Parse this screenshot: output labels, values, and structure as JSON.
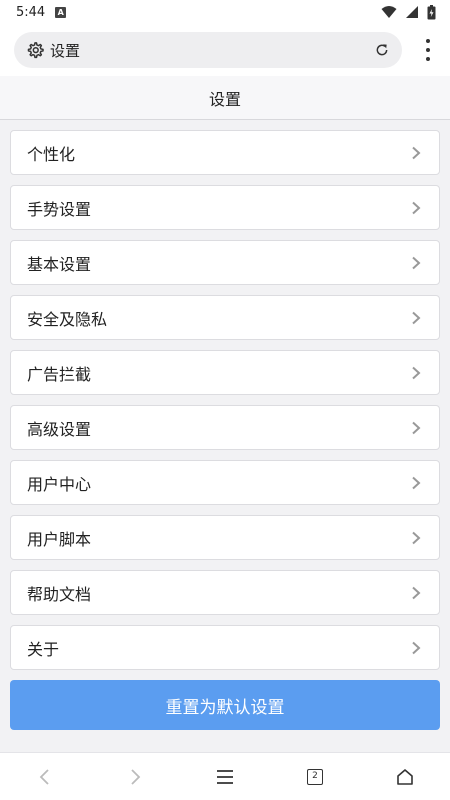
{
  "status": {
    "time": "5:44",
    "notification": "A"
  },
  "address_bar": {
    "text": "设置"
  },
  "header": {
    "title": "设置"
  },
  "settings_items": [
    {
      "label": "个性化"
    },
    {
      "label": "手势设置"
    },
    {
      "label": "基本设置"
    },
    {
      "label": "安全及隐私"
    },
    {
      "label": "广告拦截"
    },
    {
      "label": "高级设置"
    },
    {
      "label": "用户中心"
    },
    {
      "label": "用户脚本"
    },
    {
      "label": "帮助文档"
    },
    {
      "label": "关于"
    }
  ],
  "reset_button": {
    "label": "重置为默认设置"
  },
  "bottom_bar": {
    "tab_count": "2"
  },
  "colors": {
    "accent": "#5b9df0",
    "background": "#f2f2f4"
  }
}
